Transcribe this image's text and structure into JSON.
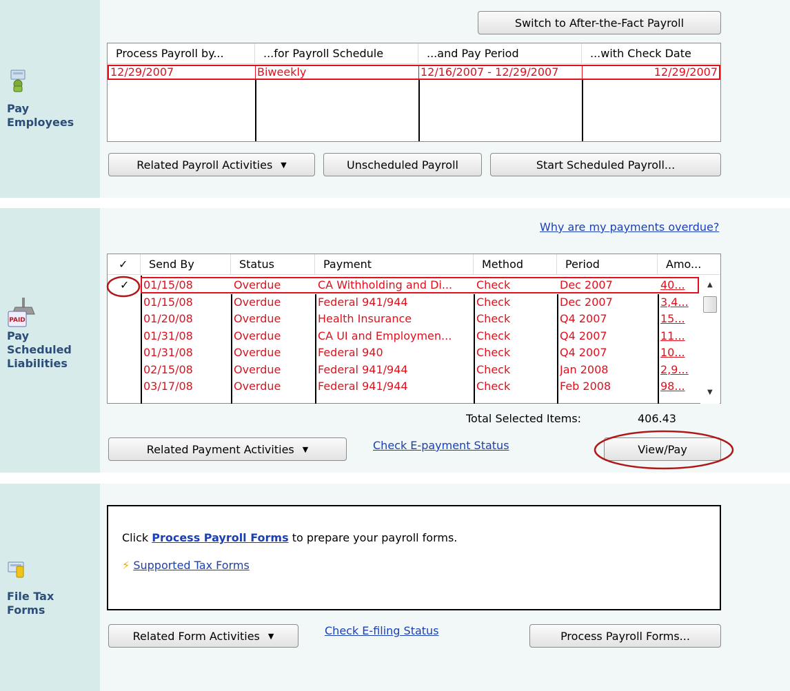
{
  "pay_employees": {
    "label": "Pay Employees",
    "label_line1": "Pay",
    "label_line2": "Employees",
    "switch_button": "Switch to After-the-Fact Payroll",
    "columns": [
      "Process Payroll by...",
      "...for Payroll Schedule",
      "...and Pay Period",
      "...with Check Date"
    ],
    "rows": [
      {
        "process_by": "12/29/2007",
        "schedule": "Biweekly",
        "pay_period": "12/16/2007 - 12/29/2007",
        "check_date": "12/29/2007"
      }
    ],
    "related_button": "Related Payroll Activities",
    "unscheduled_button": "Unscheduled Payroll",
    "start_button": "Start Scheduled Payroll..."
  },
  "liabilities": {
    "label_line1": "Pay",
    "label_line2": "Scheduled",
    "label_line3": "Liabilities",
    "overdue_link": "Why are my payments overdue?",
    "columns": [
      "✓",
      "Send By",
      "Status",
      "Payment",
      "Method",
      "Period",
      "Amo..."
    ],
    "rows": [
      {
        "checked": "✓",
        "send_by": "01/15/08",
        "status": "Overdue",
        "payment": "CA Withholding and Di...",
        "method": "Check",
        "period": "Dec 2007",
        "amount": "40..."
      },
      {
        "checked": "",
        "send_by": "01/15/08",
        "status": "Overdue",
        "payment": "Federal 941/944",
        "method": "Check",
        "period": "Dec 2007",
        "amount": "3,4..."
      },
      {
        "checked": "",
        "send_by": "01/20/08",
        "status": "Overdue",
        "payment": "Health Insurance",
        "method": "Check",
        "period": "Q4 2007",
        "amount": "15..."
      },
      {
        "checked": "",
        "send_by": "01/31/08",
        "status": "Overdue",
        "payment": "CA UI and Employmen...",
        "method": "Check",
        "period": "Q4 2007",
        "amount": "11..."
      },
      {
        "checked": "",
        "send_by": "01/31/08",
        "status": "Overdue",
        "payment": "Federal 940",
        "method": "Check",
        "period": "Q4 2007",
        "amount": "10..."
      },
      {
        "checked": "",
        "send_by": "02/15/08",
        "status": "Overdue",
        "payment": "Federal 941/944",
        "method": "Check",
        "period": "Jan 2008",
        "amount": "2,9..."
      },
      {
        "checked": "",
        "send_by": "03/17/08",
        "status": "Overdue",
        "payment": "Federal 941/944",
        "method": "Check",
        "period": "Feb 2008",
        "amount": "98..."
      }
    ],
    "total_label": "Total Selected Items:",
    "total_value": "406.43",
    "related_button": "Related Payment Activities",
    "epayment_link": "Check E-payment Status",
    "viewpay_button": "View/Pay"
  },
  "tax_forms": {
    "label_line1": "File Tax",
    "label_line2": "Forms",
    "instruction_prefix": "Click",
    "instruction_link": "Process Payroll Forms",
    "instruction_suffix": "to prepare your payroll forms.",
    "supported_link": "Supported Tax Forms",
    "related_button": "Related Form Activities",
    "efiling_link": "Check E-filing Status",
    "process_button": "Process Payroll Forms..."
  },
  "colors": {
    "overdue_red": "#e0101c",
    "link_blue": "#1b3fb5",
    "sidebar_label": "#2b4d78",
    "annotation_circle": "#b01818"
  }
}
